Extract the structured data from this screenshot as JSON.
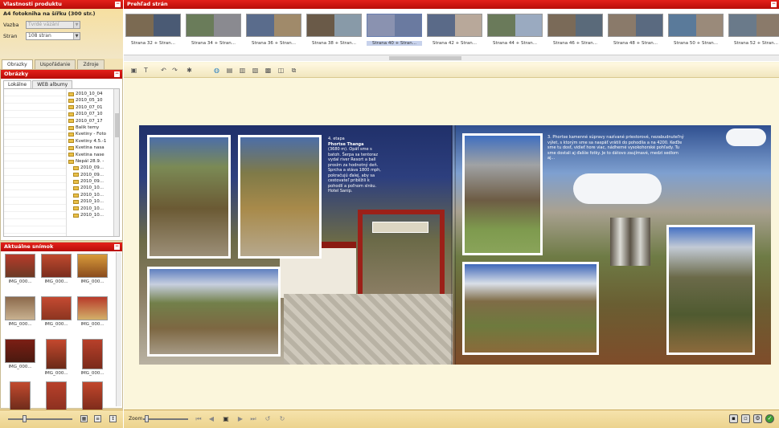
{
  "colors": {
    "accent_red": "#d3170f",
    "panel_tan": "#f3e3b5",
    "workspace": "#fbf6dc"
  },
  "left": {
    "product_panel": {
      "title": "Vlastnosti produktu",
      "product_name": "A4 fotokniha na šířku (300 str.)",
      "cover_label": "Vazba",
      "cover_value": "Tvrdé vázání",
      "pages_label": "Stran",
      "pages_value": "108 stran"
    },
    "tabs": [
      "Obrazky",
      "Uspořádanie",
      "Zdroje"
    ],
    "photos_panel": {
      "title": "Obrázky",
      "subtabs": [
        "Lokálne",
        "WEB albumy"
      ],
      "folders": [
        "2010_10_04",
        "2010_05_10",
        "2010_07_01",
        "2010_07_10",
        "2010_07_17",
        "Balik temy",
        "Kvetiny - Foto",
        "Kvetiny 4.5.-1",
        "Kvetina nasa",
        "Kvetina nase",
        "Nepál 28.9. -",
        "2010_09...",
        "2010_09...",
        "2010_09...",
        "2010_10...",
        "2010_10...",
        "2010_10...",
        "2010_10...",
        "2010_10..."
      ]
    },
    "selected_panel": {
      "title": "Aktuálne snímok",
      "items": [
        {
          "label": "IMG_000..."
        },
        {
          "label": "IMG_000..."
        },
        {
          "label": "IMG_000..."
        },
        {
          "label": "IMG_000..."
        },
        {
          "label": "IMG_000..."
        },
        {
          "label": "IMG_000..."
        },
        {
          "label": "IMG_000..."
        },
        {
          "label": "IMG_000..."
        },
        {
          "label": "IMG_000..."
        },
        {
          "label": "IMG_000..."
        },
        {
          "label": "IMG_000..."
        },
        {
          "label": "IMG_000..."
        }
      ]
    }
  },
  "right": {
    "pages_panel": {
      "title": "Prehľad strán",
      "pages": [
        {
          "label": "Strana 32 + Stran...",
          "selected": false
        },
        {
          "label": "Strana 34 + Stran...",
          "selected": false
        },
        {
          "label": "Strana 36 + Stran...",
          "selected": false
        },
        {
          "label": "Strana 38 + Stran...",
          "selected": false
        },
        {
          "label": "Strana 40 + Stran...",
          "selected": true
        },
        {
          "label": "Strana 42 + Stran...",
          "selected": false
        },
        {
          "label": "Strana 44 + Stran...",
          "selected": false
        },
        {
          "label": "Strana 46 + Stran...",
          "selected": false
        },
        {
          "label": "Strana 48 + Stran...",
          "selected": false
        },
        {
          "label": "Strana 50 + Stran...",
          "selected": false
        },
        {
          "label": "Strana 52 + Stran...",
          "selected": false
        },
        {
          "label": "Strana 54 + Stran...",
          "selected": false
        }
      ]
    },
    "spread": {
      "left_caption_head": "4. etapa",
      "left_caption_title": "Phortse Thanga",
      "left_caption_body": "(3680 m). Opäť sme s batoh. Šerpa sa tentoraz vydal river Resort a ball prosím za hodnotný deň. Sprcha a stáva 1800 mph, pokračujú ďalej, aby sa cestovateľ priblížili k pohodlí a poľnom slnku. Hotel Sanip.",
      "right_caption": "3. Phortse kamenné súpravy nazívané priestorové, nezabudnuteľný výlet, s ktorým sme sa naspäť vrátili do pohodlia a na 4200. Keďže sme tu dosť, vidieť hore viac, nádherné vysokohorské pohľady. Tu sme dostali aj ďalšie fotky. Je to dátovo zaujímavé, medzi sedlom aj..."
    },
    "bottom_bar": {
      "zoom_label": "Zoom"
    }
  }
}
